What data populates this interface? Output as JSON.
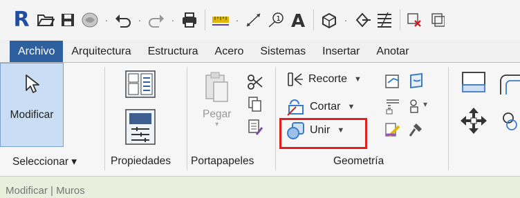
{
  "app": {
    "logo_letter": "R"
  },
  "quick_access": {
    "icons": [
      "open-icon",
      "save-icon",
      "sync-icon",
      "undo-icon",
      "redo-icon",
      "print-icon",
      "measure-icon",
      "dimension-icon",
      "tag-icon",
      "text-icon",
      "3d-view-icon",
      "section-icon",
      "thin-lines-icon",
      "close-hidden-icon"
    ]
  },
  "tabs": [
    {
      "label": "Archivo",
      "active": true
    },
    {
      "label": "Arquitectura",
      "active": false
    },
    {
      "label": "Estructura",
      "active": false
    },
    {
      "label": "Acero",
      "active": false
    },
    {
      "label": "Sistemas",
      "active": false
    },
    {
      "label": "Insertar",
      "active": false
    },
    {
      "label": "Anotar",
      "active": false
    }
  ],
  "ribbon": {
    "seleccionar": {
      "button_label": "Modificar",
      "panel_label": "Seleccionar ▾"
    },
    "propiedades": {
      "panel_label": "Propiedades"
    },
    "portapapeles": {
      "pegar_label": "Pegar",
      "panel_label": "Portapapeles"
    },
    "geometria": {
      "recorte_label": "Recorte",
      "cortar_label": "Cortar",
      "unir_label": "Unir",
      "panel_label": "Geometría"
    }
  },
  "status_bar": {
    "text": "Modificar | Muros"
  },
  "colors": {
    "accent": "#2e5f9e",
    "highlight": "#e02020",
    "selected_button": "#c9def4"
  }
}
